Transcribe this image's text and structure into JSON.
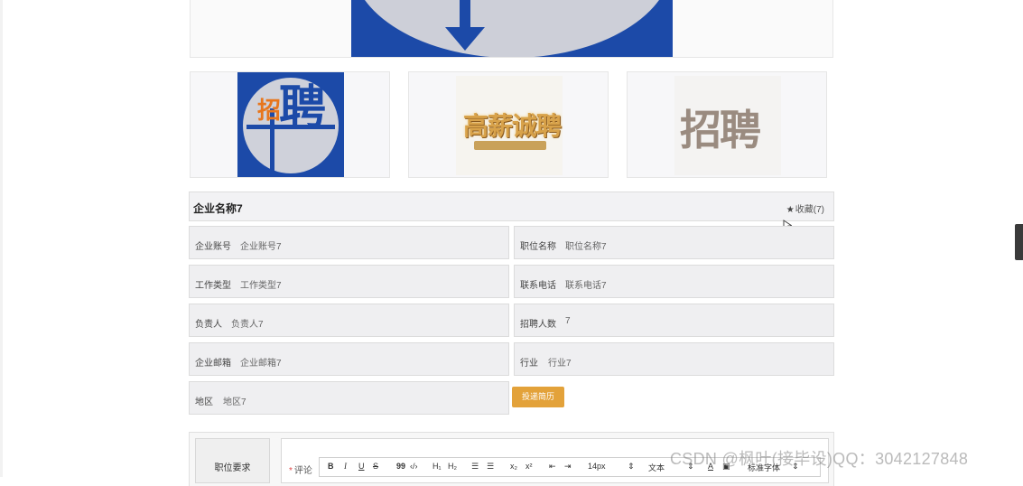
{
  "company": {
    "name": "企业名称7",
    "favorite_label": "收藏(7)"
  },
  "thumbnails": {
    "t1_char_small": "招",
    "t1_char_big": "聘",
    "t2_text": "高薪诚聘",
    "t3_text": "招聘"
  },
  "fields": {
    "account_label": "企业账号",
    "account_value": "企业账号7",
    "position_label": "职位名称",
    "position_value": "职位名称7",
    "worktype_label": "工作类型",
    "worktype_value": "工作类型7",
    "phone_label": "联系电话",
    "phone_value": "联系电话7",
    "manager_label": "负责人",
    "manager_value": "负责人7",
    "headcount_label": "招聘人数",
    "headcount_value": "7",
    "email_label": "企业邮箱",
    "email_value": "企业邮箱7",
    "industry_label": "行业",
    "industry_value": "行业7",
    "region_label": "地区",
    "region_value": "地区7"
  },
  "apply_button": "投递简历",
  "requirements": {
    "label": "职位要求",
    "comment_label": "评论"
  },
  "toolbar": {
    "bold": "B",
    "italic": "I",
    "underline": "U",
    "strike": "S",
    "quote": "99",
    "code": "‹/›",
    "h1": "H₁",
    "h2": "H₂",
    "ol": "☰",
    "ul": "☰",
    "sub": "x₂",
    "sup": "x²",
    "indent_l": "⇤",
    "indent_r": "⇥",
    "size": "14px",
    "size_arrow": "⇕",
    "text": "文本",
    "text_arrow": "⇕",
    "color": "A",
    "bg": "▣",
    "font": "标准字体",
    "font_arrow": "⇕"
  },
  "watermark": "CSDN @枫叶(接毕设)QQ：3042127848",
  "colors": {
    "brand_blue": "#1c4aa8",
    "apply_orange": "#e3a23a"
  },
  "icons": [
    "star-icon",
    "cursor-icon",
    "scrollbar-thumb"
  ]
}
